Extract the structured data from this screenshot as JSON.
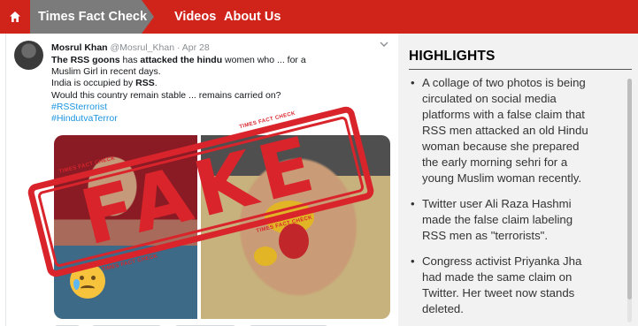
{
  "nav": {
    "section": "Times Fact Check",
    "links": [
      "Videos",
      "About Us"
    ]
  },
  "tweet": {
    "name": "Mosrul Khan",
    "handle": "@Mosrul_Khan",
    "date": "· Apr 28",
    "lines": [
      {
        "bold": "The RSS goons",
        "plain1": " has ",
        "bold2": "attacked the hindu",
        "plain2": " women who ... for a"
      },
      {
        "plain": "Muslim Girl in recent days."
      },
      {
        "plain": "India is occupied by ",
        "bold": "RSS",
        "end": "."
      },
      {
        "plain": "Would this country remain stable ... remains carried on?"
      }
    ],
    "hashtags": [
      "#RSSterrorist",
      "#HindutvaTerror"
    ]
  },
  "stamp": {
    "word": "FAKE",
    "small": "TIMES FACT CHECK"
  },
  "highlights": {
    "title": "HIGHLIGHTS",
    "items": [
      [
        "A collage of two photos is being",
        "circulated on social media",
        "platforms with a false claim that",
        "RSS men attacked an old Hindu",
        "woman because she prepared",
        "the early morning sehri for a",
        "young Muslim woman recently."
      ],
      [
        "Twitter user Ali Raza Hashmi",
        "made the false claim labeling",
        "RSS men as \"terrorists\"."
      ],
      [
        "Congress activist Priyanka Jha",
        "had made the same claim on",
        "Twitter. Her tweet now stands",
        "deleted."
      ]
    ]
  },
  "colors": {
    "nav": "#d0241b",
    "section_tab": "#7b7b7b",
    "stamp": "#d9242b",
    "hashtag": "#1b95e0",
    "panel": "#f2f2f2"
  }
}
